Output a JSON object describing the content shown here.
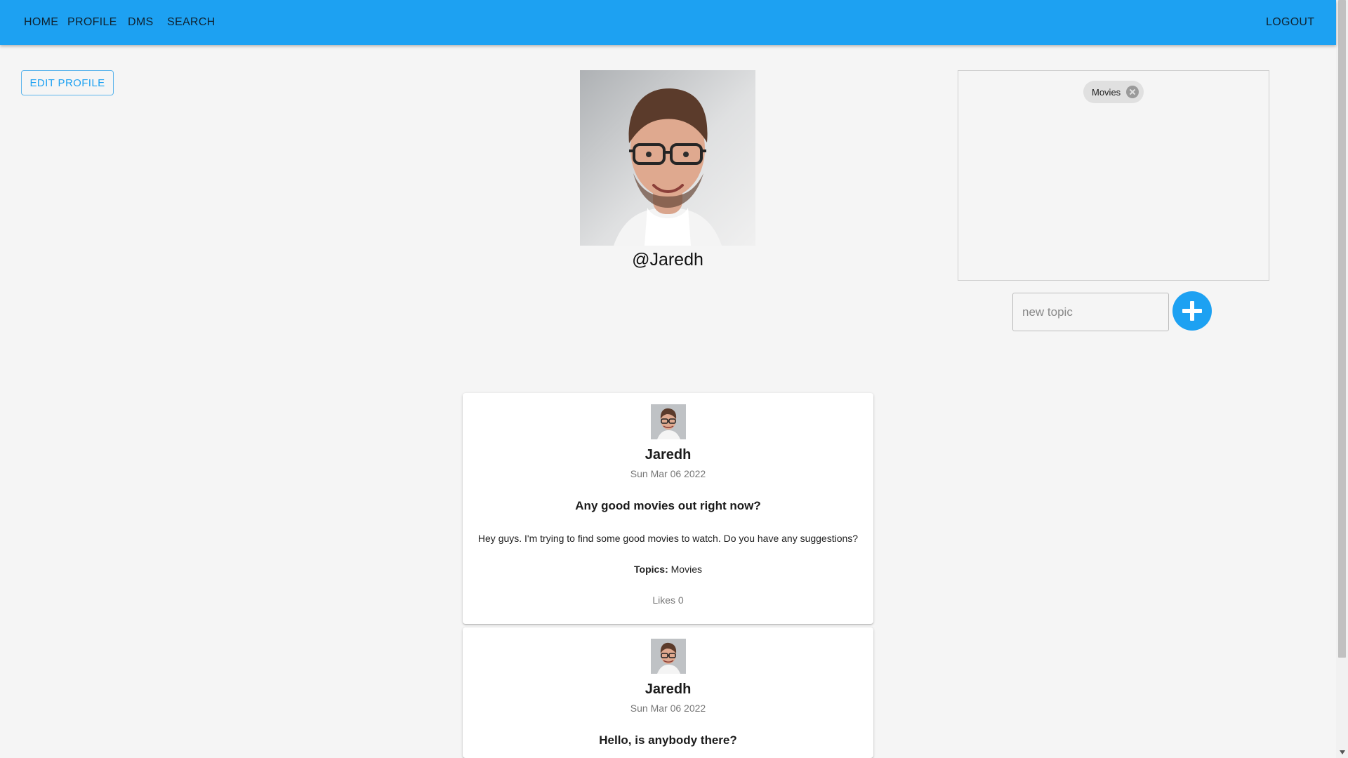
{
  "nav": {
    "home": "HOME",
    "profile": "PROFILE",
    "dms": "DMS",
    "search": "SEARCH",
    "logout": "LOGOUT"
  },
  "profile": {
    "edit_label": "EDIT PROFILE",
    "username": "@Jaredh"
  },
  "topics": {
    "items": [
      "Movies"
    ],
    "input_placeholder": "new topic",
    "input_value": ""
  },
  "posts": [
    {
      "author": "Jaredh",
      "date": "Sun Mar 06 2022",
      "title": "Any good movies out right now?",
      "body": "Hey guys. I'm trying to find some good movies to watch. Do you have any suggestions?",
      "topics_label": "Topics:",
      "topics": "Movies",
      "likes": "Likes 0"
    },
    {
      "author": "Jaredh",
      "date": "Sun Mar 06 2022",
      "title": "Hello, is anybody there?"
    }
  ],
  "colors": {
    "appbar": "#1da1f2",
    "background": "#f5f5f5",
    "accent": "#1da1f2",
    "chip": "#e0e0e0"
  },
  "icons": {
    "chip_delete": "close-circle-icon",
    "add_topic": "plus-icon"
  }
}
